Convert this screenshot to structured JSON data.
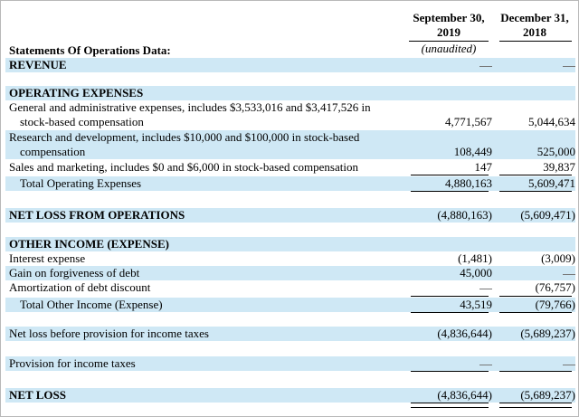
{
  "header": {
    "col1": {
      "line1": "September 30,",
      "line2": "2019",
      "line3": "(unaudited)"
    },
    "col2": {
      "line1": "December 31,",
      "line2": "2018"
    }
  },
  "section_title": "Statements Of Operations Data:",
  "revenue": {
    "label": "REVENUE",
    "v1": "—",
    "v2": "—"
  },
  "opex": {
    "heading": "OPERATING EXPENSES",
    "ga": {
      "label_line1": "General and administrative expenses, includes $3,533,016 and $3,417,526 in",
      "label_line2": "stock-based compensation",
      "v1": "4,771,567",
      "v2": "5,044,634"
    },
    "rd": {
      "label_line1": "Research and development, includes $10,000 and $100,000 in stock-based",
      "label_line2": "compensation",
      "v1": "108,449",
      "v2": "525,000"
    },
    "sm": {
      "label": "Sales and marketing, includes $0 and $6,000 in stock-based compensation",
      "v1": "147",
      "v2": "39,837"
    },
    "total": {
      "label": "Total Operating Expenses",
      "v1": "4,880,163",
      "v2": "5,609,471"
    }
  },
  "net_loss_ops": {
    "label": "NET LOSS FROM OPERATIONS",
    "v1": "(4,880,163)",
    "v2": "(5,609,471)"
  },
  "other": {
    "heading": "OTHER INCOME (EXPENSE)",
    "interest": {
      "label": "Interest expense",
      "v1": "(1,481)",
      "v2": "(3,009)"
    },
    "gain": {
      "label": "Gain on forgiveness of debt",
      "v1": "45,000",
      "v2": "—"
    },
    "amort": {
      "label": "Amortization of debt discount",
      "v1": "—",
      "v2": "(76,757)"
    },
    "total": {
      "label": "Total Other Income (Expense)",
      "v1": "43,519",
      "v2": "(79,766)"
    }
  },
  "pretax": {
    "label": "Net loss before provision for income taxes",
    "v1": "(4,836,644)",
    "v2": "(5,689,237)"
  },
  "provision": {
    "label": "Provision for income taxes",
    "v1": "—",
    "v2": "—"
  },
  "net_loss": {
    "label": "NET LOSS",
    "v1": "(4,836,644)",
    "v2": "(5,689,237)"
  }
}
